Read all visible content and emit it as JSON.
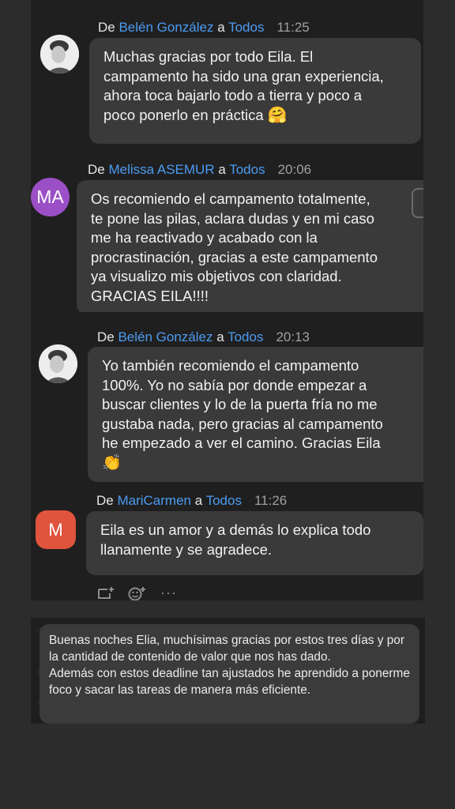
{
  "messages": [
    {
      "prefix": "De ",
      "sender": "Belén González",
      "to_word": " a ",
      "recipient": "Todos",
      "time": "11:25",
      "avatar": "photo",
      "text_lines": [
        "Muchas gracias por todo Eila. El",
        "campamento ha sido una gran experiencia,",
        "ahora toca bajarlo todo a tierra y poco a",
        "poco ponerlo en práctica"
      ],
      "emoji": "🤗"
    },
    {
      "prefix": "De ",
      "sender": "Melissa ASEMUR",
      "to_word": " a ",
      "recipient": "Todos",
      "time": "20:06",
      "avatar_initials": "MA",
      "text_lines": [
        "Os recomiendo el campamento totalmente,",
        "te pone las pilas, aclara dudas y en mi caso",
        "me ha reactivado y acabado con la",
        "procrastinación, gracias a este campamento",
        "ya visualizo mis objetivos con claridad.",
        "GRACIAS EILA!!!!"
      ]
    },
    {
      "prefix": "De ",
      "sender": "Belén González",
      "to_word": " a ",
      "recipient": "Todos",
      "time": "20:13",
      "avatar": "photo",
      "text_lines": [
        "Yo también recomiendo el campamento",
        "100%. Yo no sabía por donde empezar a",
        "buscar clientes y lo de la puerta fría no me",
        "gustaba nada, pero gracias al campamento",
        "he empezado a ver el camino. Gracias Eila"
      ],
      "emoji": "👏"
    },
    {
      "prefix": "De ",
      "sender": "MariCarmen",
      "to_word": " a ",
      "recipient": "Todos",
      "time": "11:26",
      "avatar_initials": "M",
      "text_lines": [
        "Eila es un amor y a demás lo explica todo",
        "llanamente y se agradece."
      ]
    }
  ],
  "reaction_icons": [
    "add-reaction-icon",
    "emoji-icon",
    "more-icon"
  ],
  "reaction_more": "···",
  "note": {
    "paragraph1": "Buenas noches Elia, muchísimas gracias por estos tres días y por la cantidad de contenido de valor que nos has dado.",
    "paragraph2": "Además con estos deadline tan ajustados he aprendido a ponerme foco y sacar las tareas de manera más eficiente."
  },
  "colors": {
    "background": "#2c2c2c",
    "panel": "#1f1f1f",
    "bubble": "#3a3a3a",
    "link": "#4c9bf2",
    "avatar_ma": "#9b4fc6",
    "avatar_m": "#e0533d"
  }
}
